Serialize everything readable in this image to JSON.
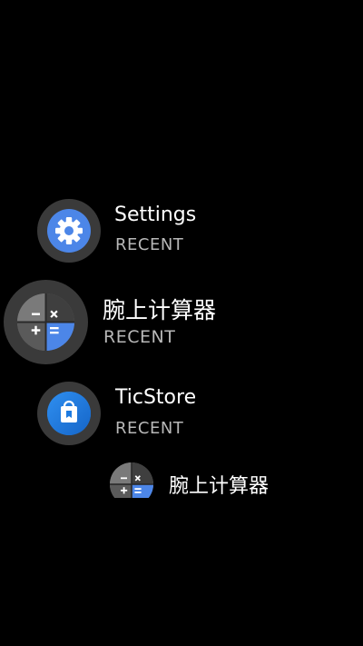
{
  "apps": [
    {
      "name": "Settings",
      "subtitle": "RECENT",
      "icon": "gear-icon"
    },
    {
      "name": "腕上计算器",
      "subtitle": "RECENT",
      "icon": "calculator-icon"
    },
    {
      "name": "TicStore",
      "subtitle": "RECENT",
      "icon": "shopping-bag-icon"
    },
    {
      "name": "腕上计算器",
      "icon": "calculator-icon"
    }
  ],
  "colors": {
    "background": "#000000",
    "icon_ring": "#3a3a3a",
    "settings_blue": "#4c86e8",
    "ticstore_blue": "#1e7be0",
    "calc_gray": "#6a6a6a",
    "calc_dark": "#3f3f3f",
    "calc_accent": "#4c86e8",
    "subtitle_gray": "#b8b8b8"
  }
}
